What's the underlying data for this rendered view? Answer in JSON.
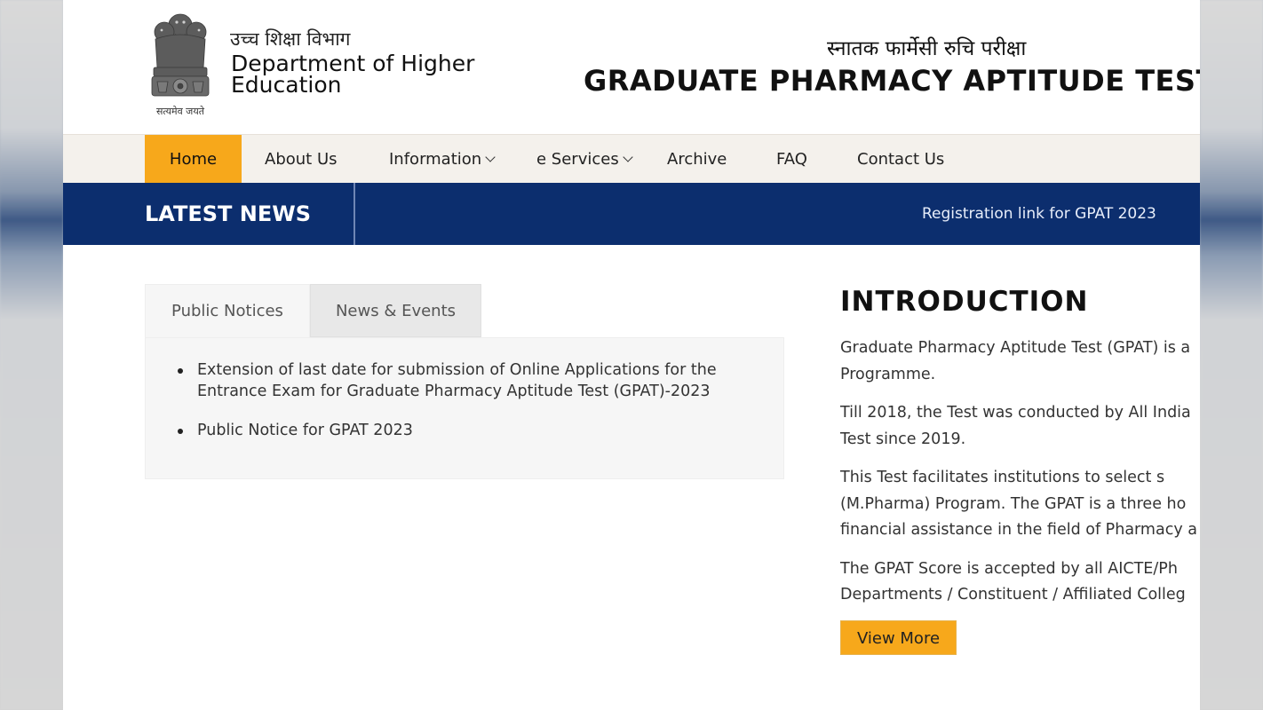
{
  "header": {
    "emblem_motto": "सत्यमेव जयते",
    "dept_hindi": "उच्च शिक्षा विभाग",
    "dept_name": "Department of Higher Education",
    "gpat_hindi": "स्नातक फार्मेसी रुचि परीक्षा",
    "gpat_title": "GRADUATE PHARMACY APTITUDE TEST("
  },
  "nav": {
    "items": [
      {
        "label": "Home",
        "active": true
      },
      {
        "label": "About Us"
      },
      {
        "label": "Information",
        "dropdown": true
      },
      {
        "label": "e Services",
        "dropdown": true
      },
      {
        "label": "Archive"
      },
      {
        "label": "FAQ"
      },
      {
        "label": "Contact Us"
      }
    ]
  },
  "latest_news": {
    "label": "LATEST NEWS",
    "ticker": "Registration link for GPAT 2023"
  },
  "tabs": {
    "items": [
      {
        "label": "Public Notices",
        "active": true
      },
      {
        "label": "News & Events"
      }
    ],
    "notices": [
      "Extension of last date for submission of Online Applications for the Entrance Exam for Graduate Pharmacy Aptitude Test (GPAT)-2023",
      "Public Notice for GPAT 2023"
    ]
  },
  "introduction": {
    "title": "INTRODUCTION",
    "paragraphs": [
      [
        "Graduate Pharmacy Aptitude Test (GPAT) is a",
        "Programme."
      ],
      [
        "Till 2018, the Test was conducted by All India",
        "Test since 2019."
      ],
      [
        "This Test facilitates institutions to select s",
        "(M.Pharma) Program. The GPAT is a three ho",
        "financial assistance in the field of Pharmacy a"
      ],
      [
        "The GPAT Score is accepted by all AICTE/Ph",
        "Departments / Constituent / Affiliated Colleg"
      ]
    ],
    "view_more_label": "View More"
  },
  "colors": {
    "accent": "#f7a81b",
    "news_bar": "#0c2e6e",
    "nav_bg": "#f4f1ec"
  },
  "icons": [
    "national-emblem-icon",
    "chevron-down-icon"
  ]
}
